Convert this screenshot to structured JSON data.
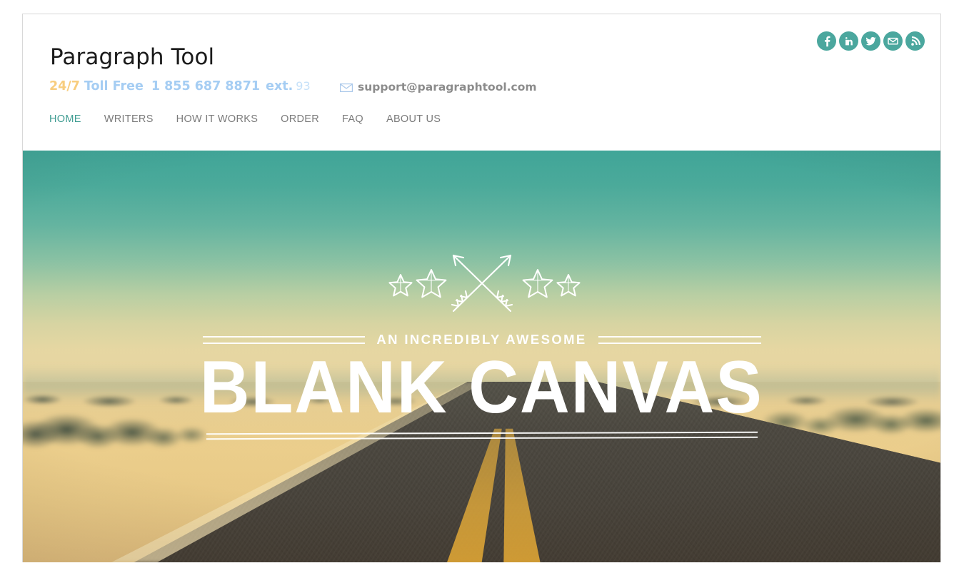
{
  "site": {
    "title": "Paragraph Tool"
  },
  "contact": {
    "availability": "24/7",
    "toll_free_label": "Toll Free",
    "phone": "1 855 687 8871",
    "ext_label": "ext.",
    "ext_number": "93",
    "email": "support@paragraphtool.com",
    "email_icon": "envelope-icon"
  },
  "social": [
    {
      "name": "facebook",
      "label": "Facebook",
      "icon": "facebook-icon"
    },
    {
      "name": "linkedin",
      "label": "LinkedIn",
      "icon": "linkedin-icon"
    },
    {
      "name": "twitter",
      "label": "Twitter",
      "icon": "twitter-icon"
    },
    {
      "name": "email",
      "label": "Email",
      "icon": "envelope-icon"
    },
    {
      "name": "rss",
      "label": "RSS",
      "icon": "rss-icon"
    }
  ],
  "nav": {
    "items": [
      {
        "label": "HOME",
        "active": true
      },
      {
        "label": "WRITERS",
        "active": false
      },
      {
        "label": "HOW IT WORKS",
        "active": false
      },
      {
        "label": "ORDER",
        "active": false
      },
      {
        "label": "FAQ",
        "active": false
      },
      {
        "label": "ABOUT US",
        "active": false
      }
    ]
  },
  "hero": {
    "emblem_icon": "crossed-arrows-and-stars-icon",
    "kicker": "AN INCREDIBLY AWESOME",
    "headline": "BLANK CANVAS"
  },
  "colors": {
    "accent_teal": "#4ba79e",
    "nav_active": "#3f9c92",
    "nav_inactive": "#7b7b7b",
    "availability_gold": "#f8cd7e",
    "phone_blue": "#a5cdf3",
    "ext_number_blue": "#c6e1f9",
    "email_gray": "#8c8c8c",
    "page_border": "#d8d8d8"
  }
}
